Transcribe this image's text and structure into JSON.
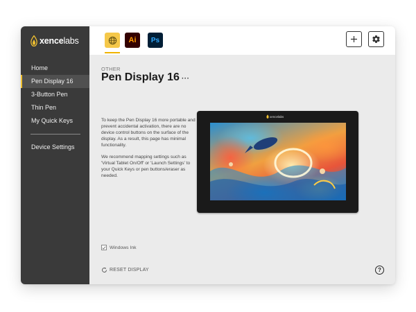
{
  "app": {
    "logo_bold": "xence",
    "logo_light": "labs"
  },
  "sidebar": {
    "items": [
      {
        "label": "Home",
        "active": false
      },
      {
        "label": "Pen Display 16",
        "active": true
      },
      {
        "label": "3-Button Pen",
        "active": false
      },
      {
        "label": "Thin Pen",
        "active": false
      },
      {
        "label": "My Quick Keys",
        "active": false
      }
    ],
    "footer_item": "Device Settings"
  },
  "toolbar": {
    "tabs": [
      {
        "name": "globe-icon",
        "label": ""
      },
      {
        "name": "illustrator-icon",
        "label": "Ai"
      },
      {
        "name": "photoshop-icon",
        "label": "Ps"
      }
    ],
    "add_icon": "plus-icon",
    "settings_icon": "gear-icon"
  },
  "page": {
    "category": "OTHER",
    "title": "Pen Display 16",
    "title_more": "···",
    "description": [
      "To keep the Pen Display 16 more portable and prevent accidental activation, there are no device control buttons on the surface of the display. As a result, this page has minimal functionality.",
      "We recommend mapping settings such as 'Virtual Tablet On/Off' or 'Launch Settings' to your Quick Keys or pen buttons/eraser as needed."
    ],
    "device_logo": "xencelabs",
    "windows_ink_label": "Windows Ink",
    "windows_ink_checked": true,
    "reset_label": "RESET DISPLAY",
    "help_label": "?"
  },
  "colors": {
    "accent": "#f0c030",
    "sidebar_bg": "#3a3a3a",
    "content_bg": "#ebebeb"
  }
}
